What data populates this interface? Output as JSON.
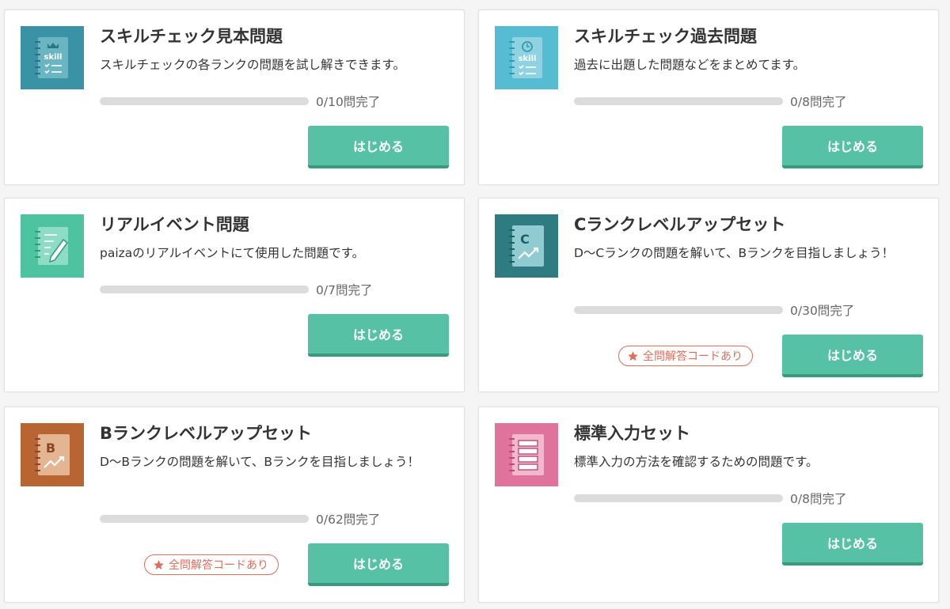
{
  "colors": {
    "accent": "#56c1a5",
    "accent_dark": "#3a9a7f",
    "badge": "#df6d5b",
    "track": "#dcdcdc"
  },
  "cards": [
    {
      "title": "スキルチェック見本問題",
      "description": "スキルチェックの各ランクの問題を試し解きできます。",
      "progress_text": "0/10問完了",
      "progress_fraction": 0,
      "button_label": "はじめる",
      "icon": "skill-notebook-icon",
      "icon_color": "#3a93a4"
    },
    {
      "title": "スキルチェック過去問題",
      "description": "過去に出題した問題などをまとめてます。",
      "progress_text": "0/8問完了",
      "progress_fraction": 0,
      "button_label": "はじめる",
      "icon": "skill-history-notebook-icon",
      "icon_color": "#55bcd2"
    },
    {
      "title": "リアルイベント問題",
      "description": "paizaのリアルイベントにて使用した問題です。",
      "progress_text": "0/7問完了",
      "progress_fraction": 0,
      "button_label": "はじめる",
      "icon": "pencil-notebook-icon",
      "icon_color": "#4ec3a0"
    },
    {
      "title": "Cランクレベルアップセット",
      "description": "D〜Cランクの問題を解いて、Bランクを目指しましょう！",
      "progress_text": "0/30問完了",
      "progress_fraction": 0,
      "button_label": "はじめる",
      "badge_label": "全問解答コードあり",
      "icon": "c-rank-chart-icon",
      "icon_color": "#2e7c82"
    },
    {
      "title": "Bランクレベルアップセット",
      "description": "D〜Bランクの問題を解いて、Bランクを目指しましょう！",
      "progress_text": "0/62問完了",
      "progress_fraction": 0,
      "button_label": "はじめる",
      "badge_label": "全問解答コードあり",
      "icon": "b-rank-chart-icon",
      "icon_color": "#b86433"
    },
    {
      "title": "標準入力セット",
      "description": "標準入力の方法を確認するための問題です。",
      "progress_text": "0/8問完了",
      "progress_fraction": 0,
      "button_label": "はじめる",
      "icon": "list-notebook-icon",
      "icon_color": "#e0739b"
    }
  ],
  "icon_labels": {
    "skill": "skill",
    "c_rank": "C",
    "b_rank": "B"
  }
}
